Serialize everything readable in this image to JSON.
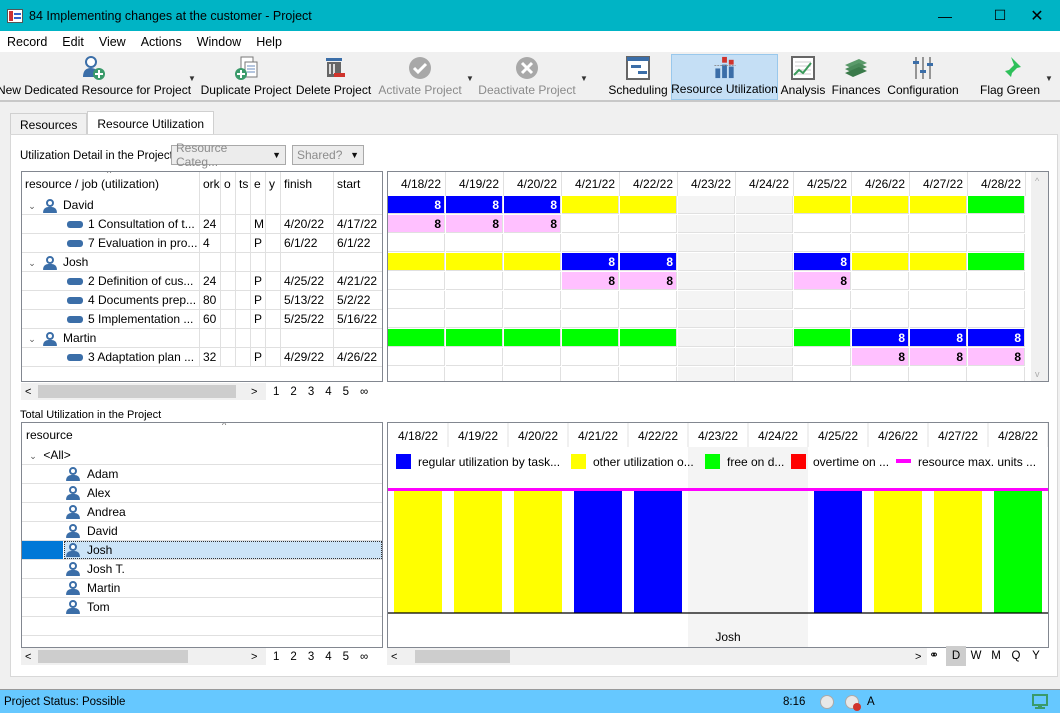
{
  "window": {
    "title": "84 Implementing changes at the customer - Project",
    "minimize": "—",
    "maximize": "☐",
    "close": "✕"
  },
  "menu": [
    "Record",
    "Edit",
    "View",
    "Actions",
    "Window",
    "Help"
  ],
  "toolbar": {
    "items": [
      {
        "label": "New Dedicated Resource for Project",
        "icon": "add-person-icon",
        "state": "enabled"
      },
      {
        "label": "Duplicate Project",
        "icon": "duplicate-icon",
        "state": "enabled"
      },
      {
        "label": "Delete Project",
        "icon": "trash-icon",
        "state": "enabled"
      },
      {
        "label": "Activate Project",
        "icon": "check-circle-icon",
        "state": "disabled"
      },
      {
        "label": "Deactivate Project",
        "icon": "x-circle-icon",
        "state": "disabled"
      },
      {
        "label": "Scheduling",
        "icon": "gantt-icon",
        "state": "enabled"
      },
      {
        "label": "Resource Utilization",
        "icon": "bar-chart-icon",
        "state": "active"
      },
      {
        "label": "Analysis",
        "icon": "trend-chart-icon",
        "state": "enabled"
      },
      {
        "label": "Finances",
        "icon": "money-icon",
        "state": "enabled"
      },
      {
        "label": "Configuration",
        "icon": "sliders-icon",
        "state": "enabled"
      },
      {
        "label": "Flag Green",
        "icon": "pin-icon",
        "state": "enabled"
      }
    ]
  },
  "tabs": [
    {
      "label": "Resources",
      "selected": false
    },
    {
      "label": "Resource Utilization",
      "selected": true
    }
  ],
  "detail": {
    "section_label": "Utilization Detail in the Project",
    "category_filter": "Resource Categ...",
    "shared_filter": "Shared?",
    "columns": [
      "resource / job (utilization)",
      "ork",
      "o",
      "ts",
      "e",
      "y",
      "finish",
      "start"
    ],
    "rows": [
      {
        "type": "resource",
        "name": "David",
        "work": "",
        "c2": "",
        "c3": "",
        "c4": "",
        "c5": "",
        "finish": "",
        "start": ""
      },
      {
        "type": "job",
        "name": "1 Consultation of t...",
        "work": "24",
        "c2": "",
        "c3": "",
        "c4": "M",
        "c5": "",
        "finish": "4/20/22",
        "start": "4/17/22"
      },
      {
        "type": "job",
        "name": "7 Evaluation in pro...",
        "work": "4",
        "c2": "",
        "c3": "",
        "c4": "P",
        "c5": "",
        "finish": "6/1/22",
        "start": "6/1/22"
      },
      {
        "type": "resource",
        "name": "Josh",
        "work": "",
        "c2": "",
        "c3": "",
        "c4": "",
        "c5": "",
        "finish": "",
        "start": ""
      },
      {
        "type": "job",
        "name": "2 Definition of cus...",
        "work": "24",
        "c2": "",
        "c3": "",
        "c4": "P",
        "c5": "",
        "finish": "4/25/22",
        "start": "4/21/22"
      },
      {
        "type": "job",
        "name": "4 Documents prep...",
        "work": "80",
        "c2": "",
        "c3": "",
        "c4": "P",
        "c5": "",
        "finish": "5/13/22",
        "start": "5/2/22"
      },
      {
        "type": "job",
        "name": "5 Implementation ...",
        "work": "60",
        "c2": "",
        "c3": "",
        "c4": "P",
        "c5": "",
        "finish": "5/25/22",
        "start": "5/16/22"
      },
      {
        "type": "resource",
        "name": "Martin",
        "work": "",
        "c2": "",
        "c3": "",
        "c4": "",
        "c5": "",
        "finish": "",
        "start": ""
      },
      {
        "type": "job",
        "name": "3 Adaptation plan ...",
        "work": "32",
        "c2": "",
        "c3": "",
        "c4": "P",
        "c5": "",
        "finish": "4/29/22",
        "start": "4/26/22"
      }
    ],
    "pages": [
      "1",
      "2",
      "3",
      "4",
      "5",
      "∞"
    ],
    "dates": [
      "4/18/22",
      "4/19/22",
      "4/20/22",
      "4/21/22",
      "4/22/22",
      "4/23/22",
      "4/24/22",
      "4/25/22",
      "4/26/22",
      "4/27/22",
      "4/28/22"
    ],
    "weekend_indices": [
      5,
      6
    ],
    "utilization": [
      [
        "B:8",
        "B:8",
        "B:8",
        "Y",
        "Y",
        "",
        "",
        "Y",
        "Y",
        "Y",
        "G"
      ],
      [
        "P:8",
        "P:8",
        "P:8",
        "",
        "",
        "",
        "",
        "",
        "",
        "",
        ""
      ],
      [
        "",
        "",
        "",
        "",
        "",
        "",
        "",
        "",
        "",
        "",
        ""
      ],
      [
        "Y",
        "Y",
        "Y",
        "B:8",
        "B:8",
        "",
        "",
        "B:8",
        "Y",
        "Y",
        "G"
      ],
      [
        "",
        "",
        "",
        "P:8",
        "P:8",
        "",
        "",
        "P:8",
        "",
        "",
        ""
      ],
      [
        "",
        "",
        "",
        "",
        "",
        "",
        "",
        "",
        "",
        "",
        ""
      ],
      [
        "",
        "",
        "",
        "",
        "",
        "",
        "",
        "",
        "",
        "",
        ""
      ],
      [
        "G",
        "G",
        "G",
        "G",
        "G",
        "",
        "",
        "G",
        "B:8",
        "B:8",
        "B:8"
      ],
      [
        "",
        "",
        "",
        "",
        "",
        "",
        "",
        "",
        "P:8",
        "P:8",
        "P:8"
      ]
    ]
  },
  "total": {
    "section_label": "Total Utilization in the Project",
    "column": "resource",
    "group": "<All>",
    "resources": [
      "Adam",
      "Alex",
      "Andrea",
      "David",
      "Josh",
      "Josh T.",
      "Martin",
      "Tom"
    ],
    "selected": "Josh",
    "pages": [
      "1",
      "2",
      "3",
      "4",
      "5",
      "∞"
    ],
    "scale_options": [
      "D",
      "W",
      "M",
      "Q",
      "Y"
    ],
    "scale_selected": "D"
  },
  "chart_data": {
    "type": "bar",
    "title": "Josh",
    "categories": [
      "4/18/22",
      "4/19/22",
      "4/20/22",
      "4/21/22",
      "4/22/22",
      "4/23/22",
      "4/24/22",
      "4/25/22",
      "4/26/22",
      "4/27/22",
      "4/28/22"
    ],
    "series": [
      {
        "name": "regular utilization by task...",
        "color": "#0000ff",
        "values": [
          0,
          0,
          0,
          8,
          8,
          0,
          0,
          8,
          0,
          0,
          0
        ]
      },
      {
        "name": "other utilization o...",
        "color": "#ffff00",
        "values": [
          8,
          8,
          8,
          0,
          0,
          0,
          0,
          0,
          8,
          8,
          0
        ]
      },
      {
        "name": "free on d...",
        "color": "#00ff00",
        "values": [
          0,
          0,
          0,
          0,
          0,
          0,
          0,
          0,
          0,
          0,
          8
        ]
      },
      {
        "name": "overtime on ...",
        "color": "#ff0000",
        "values": [
          0,
          0,
          0,
          0,
          0,
          0,
          0,
          0,
          0,
          0,
          0
        ]
      }
    ],
    "max_units_line": {
      "name": "resource max. units ...",
      "color": "#ff00ff",
      "value": 8
    },
    "ylim": [
      0,
      8
    ],
    "weekend_indices": [
      5,
      6
    ],
    "legend": "top"
  },
  "colors": {
    "B": "#0000ff",
    "Y": "#ffff00",
    "G": "#00ff00",
    "P": "#ffc0ff",
    "weekend": "#f4f4f4"
  },
  "status": {
    "text": "Project Status: Possible",
    "time": "8:16",
    "mode": "A"
  }
}
